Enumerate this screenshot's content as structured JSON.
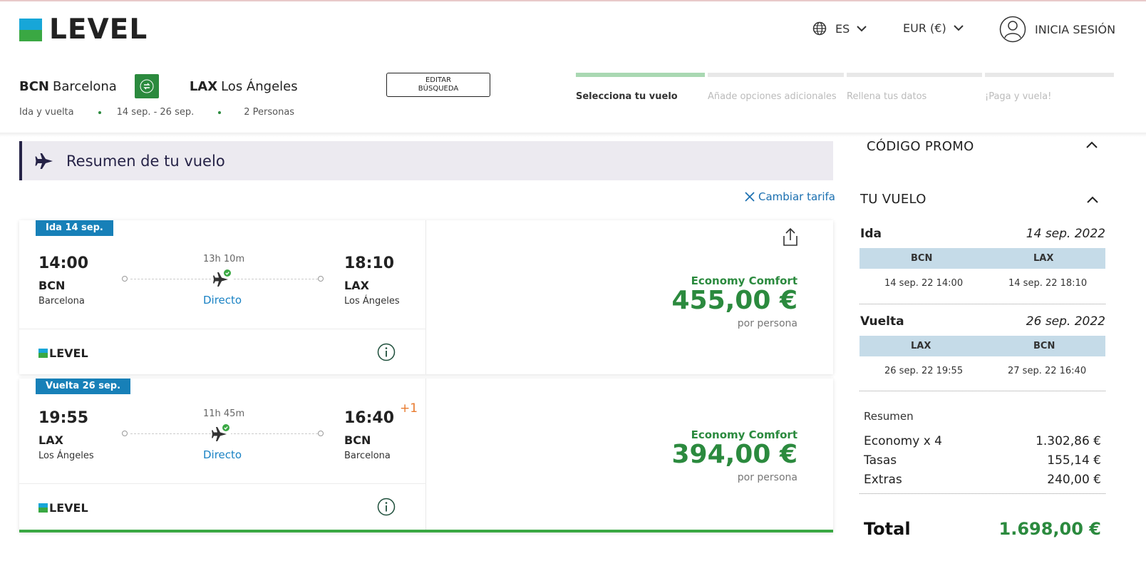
{
  "header": {
    "logo_text": "LEVEL",
    "language": "ES",
    "currency": "EUR (€)",
    "login": "INICIA SESIÓN"
  },
  "search": {
    "origin_code": "BCN",
    "origin_city": "Barcelona",
    "dest_code": "LAX",
    "dest_city": "Los Ángeles",
    "trip_type": "Ida y vuelta",
    "dates": "14 sep. - 26 sep.",
    "passengers": "2 Personas",
    "edit_label_1": "EDITAR",
    "edit_label_2": "BÚSQUEDA"
  },
  "steps": [
    {
      "label": "Selecciona tu vuelo",
      "active": true
    },
    {
      "label": "Añade opciones adicionales",
      "active": false
    },
    {
      "label": "Rellena tus datos",
      "active": false
    },
    {
      "label": "¡Paga y vuela!",
      "active": false
    }
  ],
  "summary": {
    "title": "Resumen de tu vuelo",
    "change_fare": "Cambiar tarifa"
  },
  "flights": [
    {
      "tag": "Ida 14 sep.",
      "dep_time": "14:00",
      "dep_code": "BCN",
      "dep_city": "Barcelona",
      "arr_time": "18:10",
      "arr_code": "LAX",
      "arr_city": "Los Ángeles",
      "duration": "13h 10m",
      "type": "Directo",
      "day_offset": "",
      "airline": "LEVEL",
      "fare": "Economy Comfort",
      "price": "455,00 €",
      "per": "por persona"
    },
    {
      "tag": "Vuelta 26 sep.",
      "dep_time": "19:55",
      "dep_code": "LAX",
      "dep_city": "Los Ángeles",
      "arr_time": "16:40",
      "arr_code": "BCN",
      "arr_city": "Barcelona",
      "duration": "11h 45m",
      "type": "Directo",
      "day_offset": "+1",
      "airline": "LEVEL",
      "fare": "Economy Comfort",
      "price": "394,00 €",
      "per": "por persona"
    }
  ],
  "panel": {
    "promo": "CÓDIGO PROMO",
    "your_flight": "TU VUELO",
    "legs": [
      {
        "label": "Ida",
        "date": "14 sep. 2022",
        "from": "BCN",
        "to": "LAX",
        "from_dt": "14 sep. 22 14:00",
        "to_dt": "14 sep. 22 18:10"
      },
      {
        "label": "Vuelta",
        "date": "26 sep. 2022",
        "from": "LAX",
        "to": "BCN",
        "from_dt": "26 sep. 22 19:55",
        "to_dt": "27 sep. 22 16:40"
      }
    ],
    "summary_title": "Resumen",
    "lines": [
      {
        "label": "Economy x 4",
        "value": "1.302,86 €"
      },
      {
        "label": "Tasas",
        "value": "155,14 €"
      },
      {
        "label": "Extras",
        "value": "240,00 €"
      }
    ],
    "total_label": "Total",
    "total_value": "1.698,00 €"
  },
  "colors": {
    "brand_green": "#2b8a3e",
    "brand_blue": "#17a6d8",
    "tag_blue": "#1780b8",
    "navy": "#262347"
  }
}
